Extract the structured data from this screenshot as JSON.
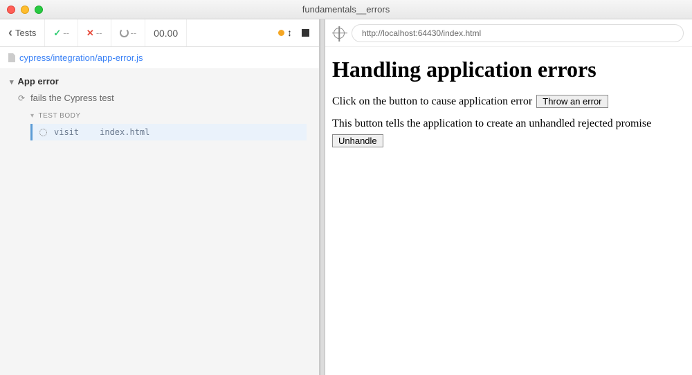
{
  "window": {
    "title": "fundamentals__errors"
  },
  "toolbar": {
    "back_label": "Tests",
    "passed": "--",
    "failed": "--",
    "pending": "--",
    "time": "00.00"
  },
  "file": {
    "path": "cypress/integration/app-error.js"
  },
  "tree": {
    "describe": "App error",
    "test": "fails the Cypress test",
    "body_label": "TEST BODY",
    "command": {
      "name": "visit",
      "arg": "index.html"
    }
  },
  "urlbar": {
    "url": "http://localhost:64430/index.html"
  },
  "aut": {
    "heading": "Handling application errors",
    "line1": "Click on the button to cause application error",
    "btn1": "Throw an error",
    "line2": "This button tells the application to create an unhandled rejected promise",
    "btn2": "Unhandle"
  }
}
